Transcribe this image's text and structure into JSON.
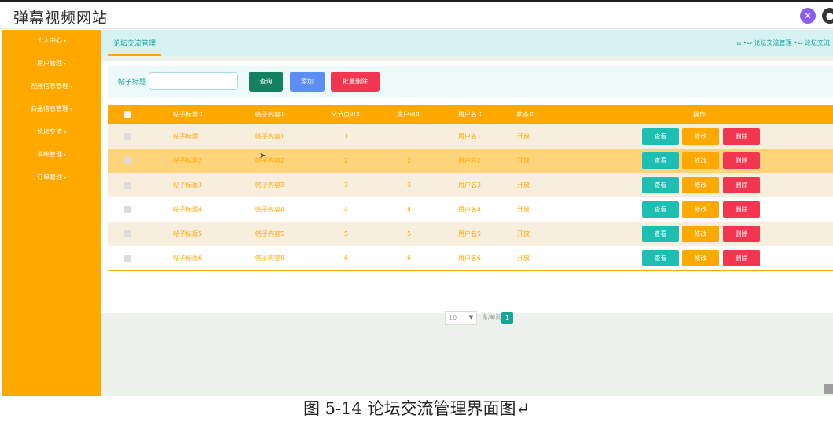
{
  "app": {
    "title": "弹幕视频网站"
  },
  "header": {
    "icon1": "palette-icon",
    "icon2": "user-icon"
  },
  "sidebar": {
    "items": [
      {
        "label": "个人中心"
      },
      {
        "label": "用户管理"
      },
      {
        "label": "视频信息管理"
      },
      {
        "label": "商品信息管理"
      },
      {
        "label": "论坛交流"
      },
      {
        "label": "系统管理"
      },
      {
        "label": "订单管理"
      }
    ],
    "arrow": "▾"
  },
  "tabs": {
    "active": "论坛交流管理"
  },
  "breadcrumb": {
    "home_icon": "home-icon",
    "sep": "•⇔",
    "item1": "论坛交流管理",
    "item2": "论坛交流"
  },
  "search": {
    "label": "帖子标题",
    "value": "",
    "placeholder": ""
  },
  "buttons": {
    "query": "查询",
    "add": "添加",
    "batch_delete": "批量删除"
  },
  "table": {
    "headers": [
      "帖子标题⇕",
      "帖子内容⇕",
      "父节点id⇕",
      "用户id⇕",
      "用户名⇕",
      "状态⇕",
      "操作"
    ],
    "rows": [
      {
        "title": "帖子标题1",
        "content": "帖子内容1",
        "parentid": "1",
        "userid": "1",
        "username": "用户名1",
        "status": "开放"
      },
      {
        "title": "帖子标题2",
        "content": "帖子内容2",
        "parentid": "2",
        "userid": "2",
        "username": "用户名2",
        "status": "开放"
      },
      {
        "title": "帖子标题3",
        "content": "帖子内容3",
        "parentid": "3",
        "userid": "3",
        "username": "用户名3",
        "status": "开放"
      },
      {
        "title": "帖子标题4",
        "content": "帖子内容4",
        "parentid": "4",
        "userid": "4",
        "username": "用户名4",
        "status": "开放"
      },
      {
        "title": "帖子标题5",
        "content": "帖子内容5",
        "parentid": "5",
        "userid": "5",
        "username": "用户名5",
        "status": "开放"
      },
      {
        "title": "帖子标题6",
        "content": "帖子内容6",
        "parentid": "6",
        "userid": "6",
        "username": "用户名6",
        "status": "开放"
      }
    ],
    "actions": {
      "view": "查看",
      "edit": "修改",
      "delete": "删除"
    }
  },
  "pagination": {
    "page_size": "10",
    "page_size_label": "条/每页",
    "current_page": "1"
  },
  "caption": "图 5-14 论坛交流管理界面图↵",
  "colors": {
    "accent": "#ffa800",
    "teal": "#1aa39a",
    "danger": "#f2364f",
    "primary": "#5b8ef0"
  }
}
